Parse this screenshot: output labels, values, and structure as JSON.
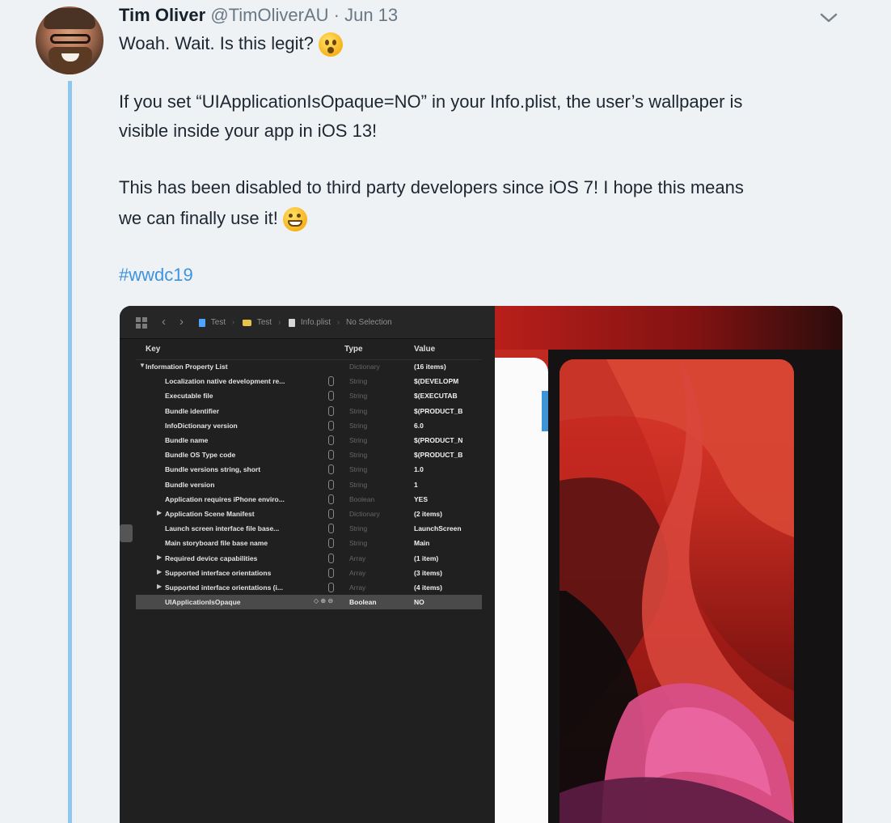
{
  "tweet": {
    "author": {
      "name": "Tim Oliver",
      "handle": "@TimOliverAU",
      "separator": "·",
      "date": "Jun 13"
    },
    "text_lines": [
      "Woah. Wait. Is this legit?",
      "If you set “UIApplicationIsOpaque=NO” in your Info.plist, the user’s wallpaper is",
      "visible inside your app in iOS 13!",
      "This has been disabled to third party developers since iOS 7! I hope this means",
      "we can finally use it!"
    ],
    "hashtag": "#wwdc19",
    "colors": {
      "accent": "#3d93df",
      "thread": "#8fc7ee"
    }
  },
  "xcode": {
    "breadcrumbs": [
      "Test",
      "Test",
      "Info.plist",
      "No Selection"
    ],
    "columns": {
      "key": "Key",
      "type": "Type",
      "value": "Value"
    },
    "rows": [
      {
        "key": "Information Property List",
        "type": "Dictionary",
        "value": "(16 items)",
        "level": 0,
        "disclosure": "▼",
        "selected": false
      },
      {
        "key": "Localization native development re...",
        "type": "String",
        "value": "$(DEVELOPM",
        "level": 1,
        "disclosure": "",
        "selected": false
      },
      {
        "key": "Executable file",
        "type": "String",
        "value": "$(EXECUTAB",
        "level": 1,
        "disclosure": "",
        "selected": false
      },
      {
        "key": "Bundle identifier",
        "type": "String",
        "value": "$(PRODUCT_B",
        "level": 1,
        "disclosure": "",
        "selected": false
      },
      {
        "key": "InfoDictionary version",
        "type": "String",
        "value": "6.0",
        "level": 1,
        "disclosure": "",
        "selected": false
      },
      {
        "key": "Bundle name",
        "type": "String",
        "value": "$(PRODUCT_N",
        "level": 1,
        "disclosure": "",
        "selected": false
      },
      {
        "key": "Bundle OS Type code",
        "type": "String",
        "value": "$(PRODUCT_B",
        "level": 1,
        "disclosure": "",
        "selected": false
      },
      {
        "key": "Bundle versions string, short",
        "type": "String",
        "value": "1.0",
        "level": 1,
        "disclosure": "",
        "selected": false
      },
      {
        "key": "Bundle version",
        "type": "String",
        "value": "1",
        "level": 1,
        "disclosure": "",
        "selected": false
      },
      {
        "key": "Application requires iPhone enviro...",
        "type": "Boolean",
        "value": "YES",
        "level": 1,
        "disclosure": "",
        "selected": false
      },
      {
        "key": "Application Scene Manifest",
        "type": "Dictionary",
        "value": "(2 items)",
        "level": 1,
        "disclosure": "▶",
        "selected": false
      },
      {
        "key": "Launch screen interface file base...",
        "type": "String",
        "value": "LaunchScreen",
        "level": 1,
        "disclosure": "",
        "selected": false
      },
      {
        "key": "Main storyboard file base name",
        "type": "String",
        "value": "Main",
        "level": 1,
        "disclosure": "",
        "selected": false
      },
      {
        "key": "Required device capabilities",
        "type": "Array",
        "value": "(1 item)",
        "level": 1,
        "disclosure": "▶",
        "selected": false
      },
      {
        "key": "Supported interface orientations",
        "type": "Array",
        "value": "(3 items)",
        "level": 1,
        "disclosure": "▶",
        "selected": false
      },
      {
        "key": "Supported interface orientations (i...",
        "type": "Array",
        "value": "(4 items)",
        "level": 1,
        "disclosure": "▶",
        "selected": false
      },
      {
        "key": "UIApplicationIsOpaque",
        "type": "Boolean",
        "value": "NO",
        "level": 1,
        "disclosure": "",
        "selected": true
      }
    ]
  }
}
